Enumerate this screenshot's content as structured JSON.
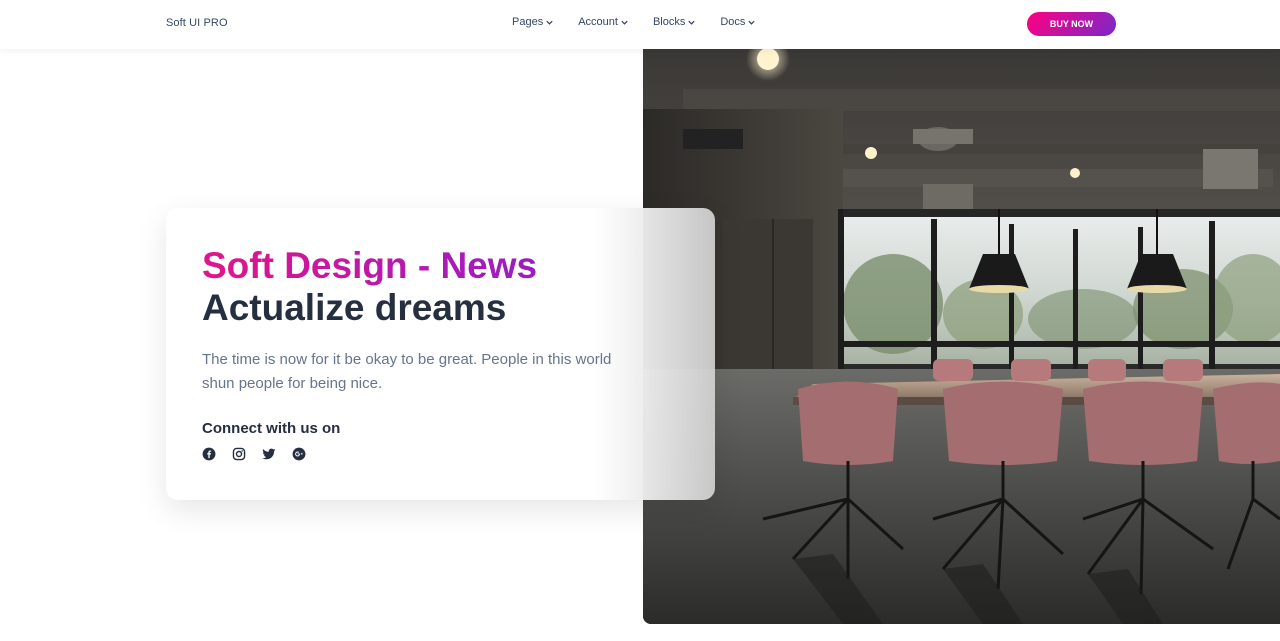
{
  "navbar": {
    "brand": "Soft UI PRO",
    "links": [
      {
        "label": "Pages"
      },
      {
        "label": "Account"
      },
      {
        "label": "Blocks"
      },
      {
        "label": "Docs"
      }
    ],
    "cta": "BUY NOW"
  },
  "hero": {
    "title_gradient": "Soft Design - News",
    "title": "Actualize dreams",
    "description": "The time is now for it be okay to be great. People in this world shun people for being nice.",
    "connect_label": "Connect with us on",
    "socials": [
      "facebook-icon",
      "instagram-icon",
      "twitter-icon",
      "google-plus-icon"
    ]
  },
  "colors": {
    "accent_start": "#FF0080",
    "accent_end": "#7928CA",
    "text_dark": "#252f40",
    "text_muted": "#67748e"
  }
}
